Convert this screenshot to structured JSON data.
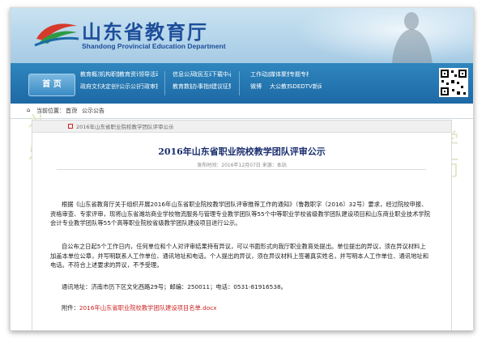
{
  "header": {
    "site_title": "山东省教育厅",
    "site_subtitle": "Shandong Provincial Education Department"
  },
  "nav": {
    "home_label": "首 页",
    "group1": [
      [
        "教育概况",
        "机构职能",
        "教育资讯",
        "领导活动"
      ],
      [
        "政府文件",
        "决定创作",
        "公示公告",
        "行政审批"
      ]
    ],
    "group2": [
      [
        "信息公开",
        "政民互动",
        "下载中心"
      ],
      [
        "教育数据",
        "办事指南",
        "建议征集"
      ]
    ],
    "group3": [
      [
        "工作动态",
        "媒体聚焦",
        "专题专栏"
      ],
      [
        "微博",
        "大公教育",
        "SDEDTV新闻"
      ]
    ]
  },
  "breadcrumb": {
    "label": "当前位置：",
    "home": "首页",
    "section": "公示公告"
  },
  "article": {
    "subbar_text": "2016年山东省职业院校教学团队评审公示",
    "title": "2016年山东省职业院校教学团队评审公示",
    "meta": "发布时间：2016年12月07日  来源：本站",
    "paragraphs": [
      "根据《山东省教育厅关于组织开展2016年山东省职业院校教学团队评审推荐工作的通知》（鲁教职字〔2016〕32号）要求，经过院校申报、资格审查、专家评审，现将山东省潍坊商业学校物流服务与管理专业教学团队等55个中等职业学校省级教学团队建设项目和山东商业职业技术学院会计专业教学团队等55个高等职业院校省级教学团队建设项目进行公示。",
      "自公布之日起5个工作日内，任何单位和个人对评审结果持有异议，可以书面形式向我厅职业教育处提出。单位提出的异议，须在异议材料上加盖本单位公章，并写明联系人工作单位、通讯地址和电话。个人提出的异议，须在异议材料上签署真实姓名，并写明本人工作单位、通讯地址和电话。不符合上述要求的异议，不予受理。",
      "通讯地址：济南市历下区文化西路29号；邮编：250011；电话：0531-81916538。"
    ],
    "attachment_label": "附件：",
    "attachment_link": "2016年山东省职业院校教学团队建设项目名单.docx"
  },
  "colors": {
    "nav_blue": "#1d69a5",
    "title_blue": "#1d4e9a",
    "link_red": "#cc2222"
  }
}
